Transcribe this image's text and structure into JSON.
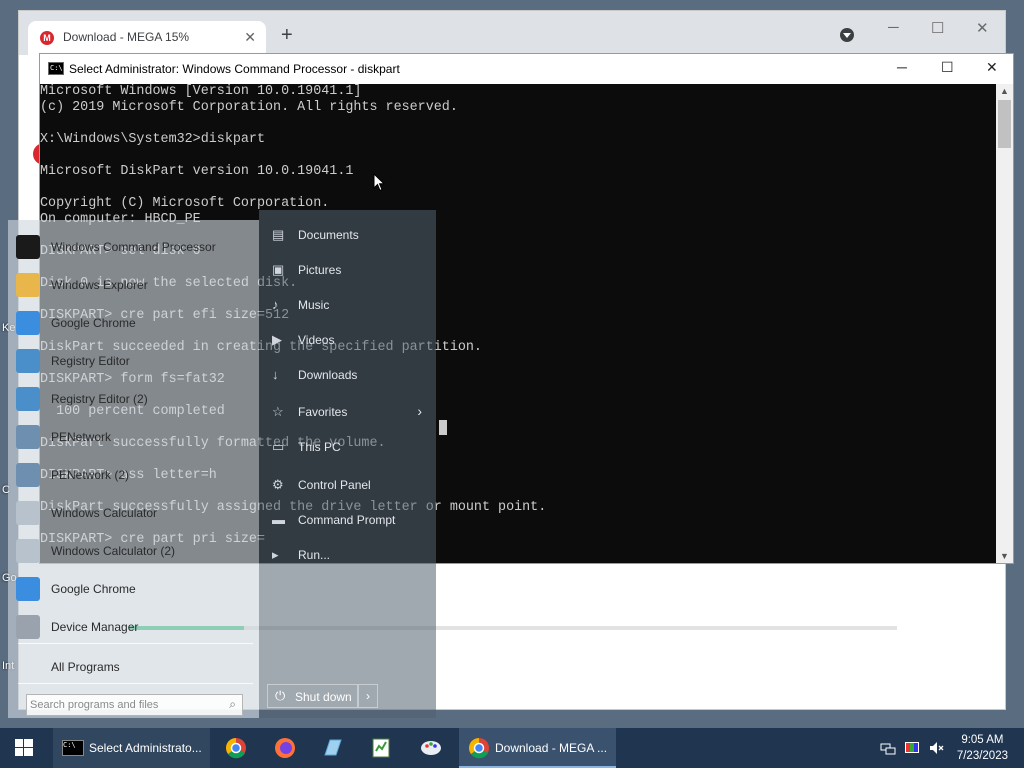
{
  "desktop_labels": [
    "Ke",
    "C",
    "Go",
    "Int"
  ],
  "chrome": {
    "tab_title": "Download - MEGA 15%",
    "tab_close": "✕",
    "new_tab": "+",
    "minimize": "─",
    "maximize": "☐",
    "close": "✕",
    "download_progress": 0.15
  },
  "cmd": {
    "title": "Select Administrator: Windows Command Processor - diskpart",
    "minimize": "─",
    "maximize": "☐",
    "close": "✕",
    "lines": [
      "Microsoft Windows [Version 10.0.19041.1]",
      "(c) 2019 Microsoft Corporation. All rights reserved.",
      "",
      "X:\\Windows\\System32>diskpart",
      "",
      "Microsoft DiskPart version 10.0.19041.1",
      "",
      "Copyright (C) Microsoft Corporation.",
      "On computer: HBCD_PE",
      "",
      "DISKPART> sel disk 0",
      "",
      "Disk 0 is now the selected disk.",
      "",
      "DISKPART> cre part efi size=512",
      "",
      "DiskPart succeeded in creating the specified partition.",
      "",
      "DISKPART> form fs=fat32",
      "",
      "  100 percent completed",
      "",
      "DiskPart successfully formatted the volume.",
      "",
      "DISKPART> ass letter=h",
      "",
      "DiskPart successfully assigned the drive letter or mount point.",
      "",
      "DISKPART> cre part pri size="
    ]
  },
  "start_menu": {
    "programs": [
      {
        "label": "Windows Command Processor",
        "icon": "cmd-icon",
        "color": "#1a1a1a"
      },
      {
        "label": "Windows Explorer",
        "icon": "folder-icon",
        "color": "#e8b64a"
      },
      {
        "label": "Google Chrome",
        "icon": "chrome-icon",
        "color": "#3b8de0"
      },
      {
        "label": "Registry Editor",
        "icon": "registry-icon",
        "color": "#4a8fc9"
      },
      {
        "label": "Registry Editor (2)",
        "icon": "registry-icon",
        "color": "#4a8fc9"
      },
      {
        "label": "PENetwork",
        "icon": "network-icon",
        "color": "#6f8fb0"
      },
      {
        "label": "PENetwork (2)",
        "icon": "network-icon",
        "color": "#6f8fb0"
      },
      {
        "label": "Windows Calculator",
        "icon": "calculator-icon",
        "color": "#b8c2cc"
      },
      {
        "label": "Windows Calculator (2)",
        "icon": "calculator-icon",
        "color": "#b8c2cc"
      },
      {
        "label": "Google Chrome",
        "icon": "chrome-icon",
        "color": "#3b8de0"
      },
      {
        "label": "Device Manager",
        "icon": "device-manager-icon",
        "color": "#9aa3ad"
      }
    ],
    "all_programs": "All Programs",
    "search_placeholder": "Search programs and files",
    "right_items": [
      {
        "label": "Documents",
        "icon": "document-icon",
        "glyph": "▤"
      },
      {
        "label": "Pictures",
        "icon": "pictures-icon",
        "glyph": "▣"
      },
      {
        "label": "Music",
        "icon": "music-icon",
        "glyph": "♪"
      },
      {
        "label": "Videos",
        "icon": "videos-icon",
        "glyph": "▶"
      },
      {
        "label": "Downloads",
        "icon": "downloads-icon",
        "glyph": "↓"
      },
      {
        "label": "Favorites",
        "icon": "favorites-icon",
        "glyph": "☆"
      },
      {
        "label": "This PC",
        "icon": "computer-icon",
        "glyph": "▭"
      },
      {
        "label": "Control Panel",
        "icon": "control-panel-icon",
        "glyph": "⚙"
      },
      {
        "label": "Command Prompt",
        "icon": "cmd-icon",
        "glyph": "▬"
      },
      {
        "label": "Run...",
        "icon": "run-icon",
        "glyph": "▸"
      }
    ],
    "favorites_arrow": "›",
    "shutdown_label": "Shut down",
    "shutdown_arrow": "›"
  },
  "taskbar": {
    "cmd_task": "Select Administrato...",
    "chrome_task": "Download - MEGA ...",
    "time": "9:05 AM",
    "date": "7/23/2023"
  },
  "colors": {
    "taskbar": "#1f3550",
    "console_bg": "#0c0c0c",
    "console_text": "#cccccc",
    "mega_red": "#d9272e"
  }
}
